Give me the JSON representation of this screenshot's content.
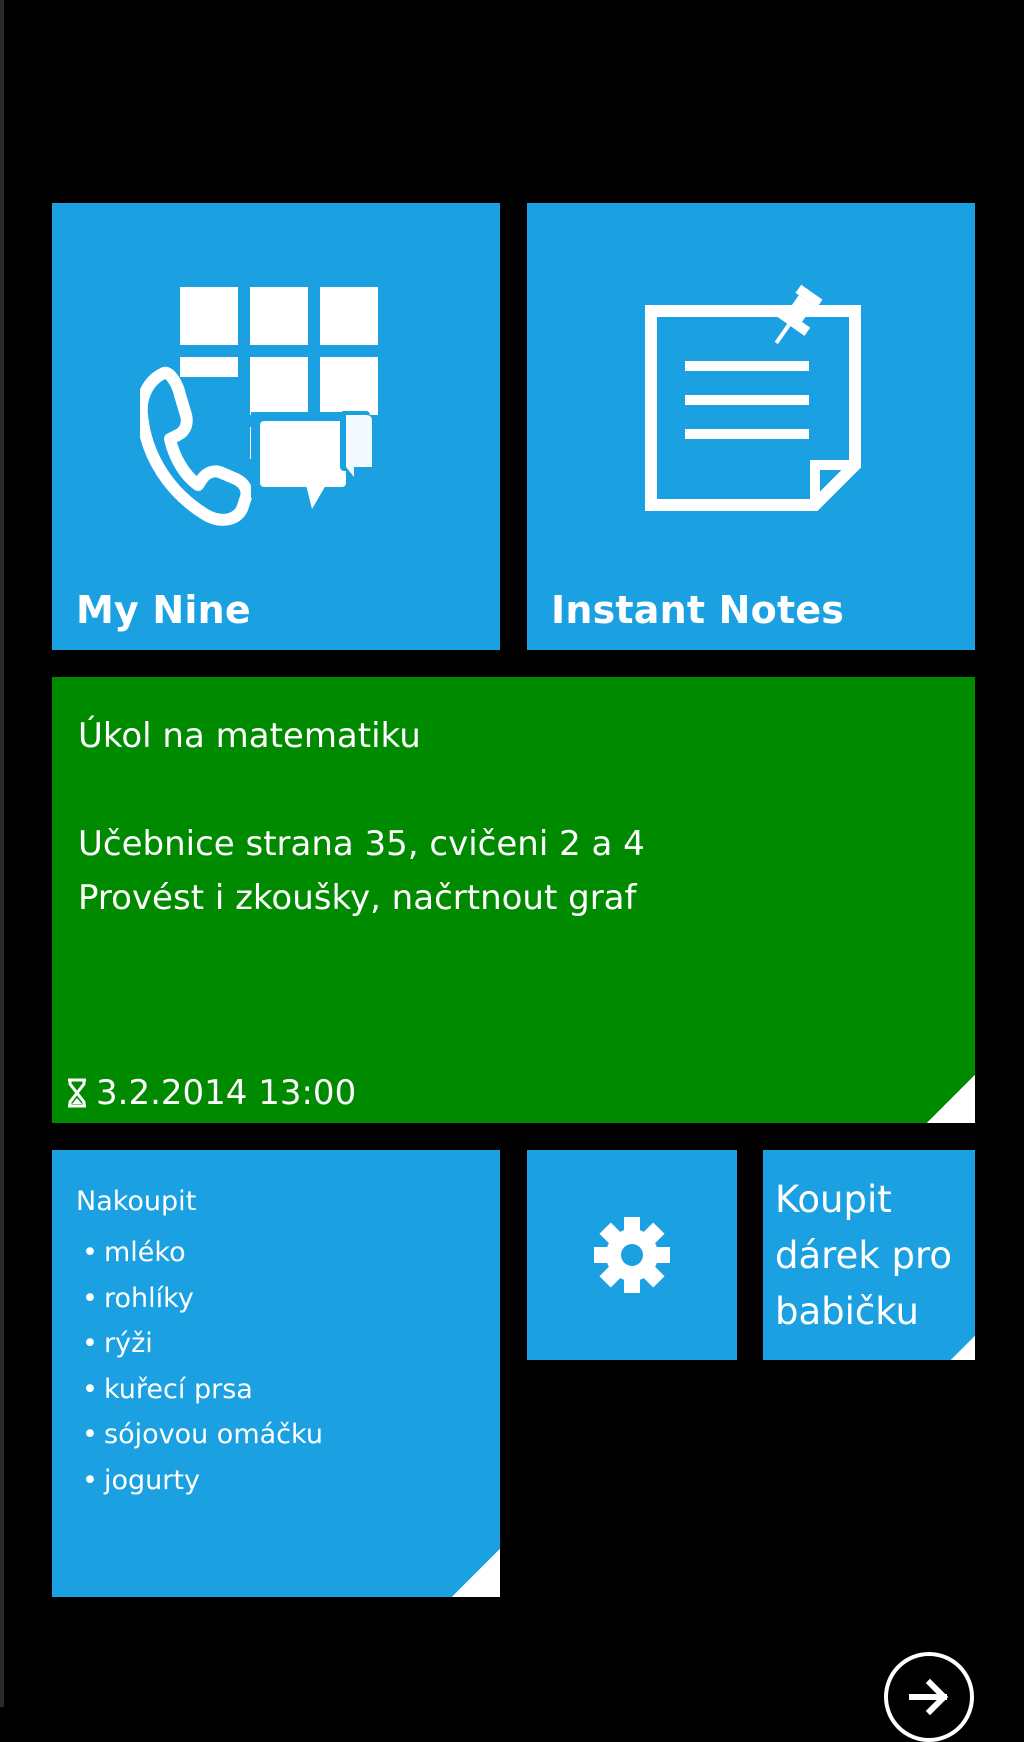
{
  "tiles": {
    "my_nine": {
      "title": "My Nine",
      "icon": "phone-keypad-chat-icon"
    },
    "instant_notes": {
      "title": "Instant Notes",
      "icon": "pinned-note-icon"
    },
    "math_note": {
      "text": "Úkol na matematiku\n\nUčebnice strana 35, cvičeni 2 a 4\nProvést i zkoušky, načrtnout graf",
      "reminder": "3.2.2014 13:00",
      "reminder_icon": "hourglass-icon"
    },
    "shopping_note": {
      "heading": "Nakoupit",
      "items": [
        "mléko",
        "rohlíky",
        "rýži",
        "kuřecí prsa",
        "sójovou omáčku",
        "jogurty"
      ]
    },
    "settings": {
      "icon": "gear-icon"
    },
    "gift_note": {
      "text": "Koupit\ndárek pro\nbabičku"
    }
  },
  "appbar": {
    "next_icon": "arrow-right-circle-icon"
  },
  "colors": {
    "background": "#000000",
    "tile_blue": "#1ba1e2",
    "tile_green": "#008a00",
    "foreground": "#ffffff"
  }
}
